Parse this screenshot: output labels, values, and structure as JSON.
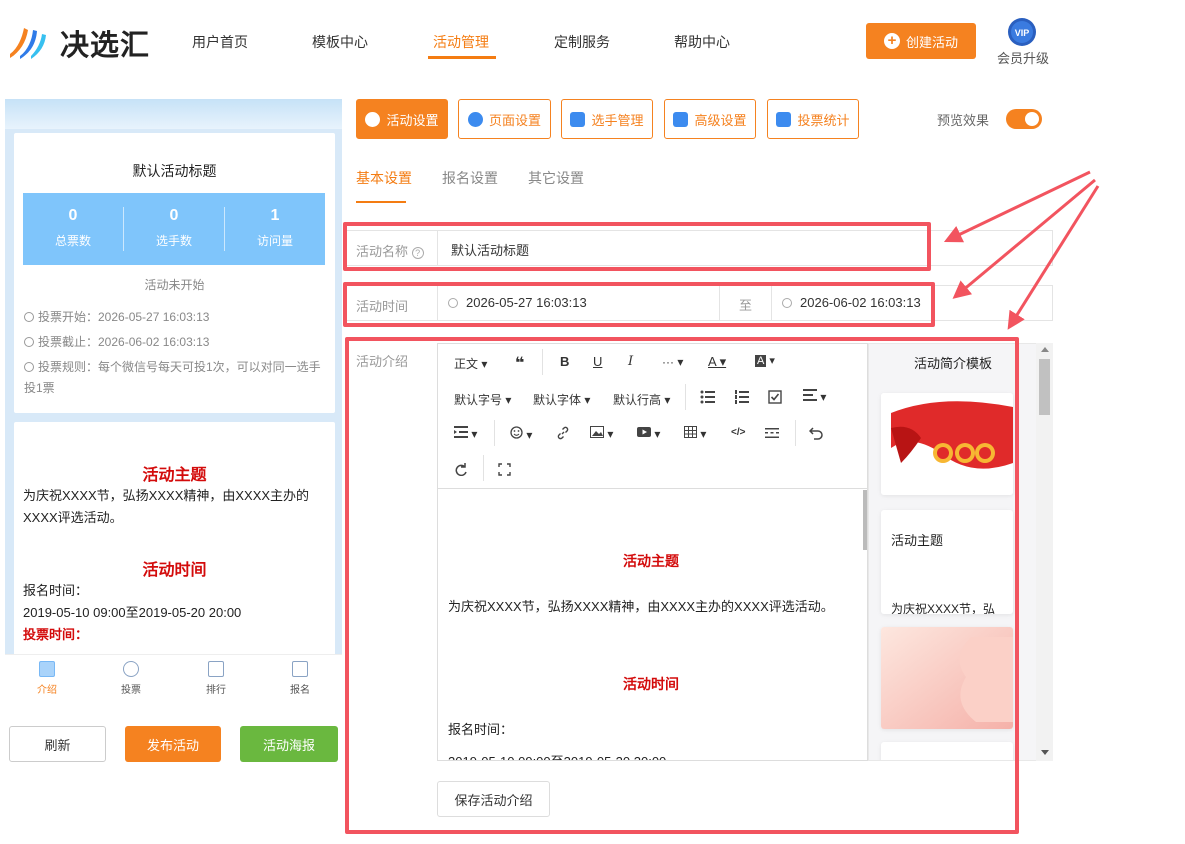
{
  "brand": {
    "name": "决选汇",
    "logo_icon": "logo-icon"
  },
  "nav": {
    "items": [
      "用户首页",
      "模板中心",
      "活动管理",
      "定制服务",
      "帮助中心"
    ],
    "active": "活动管理"
  },
  "header": {
    "create_label": "创建活动",
    "vip_badge": "VIP",
    "vip_label": "会员升级"
  },
  "preview": {
    "title": "默认活动标题",
    "stats": [
      {
        "value": "0",
        "label": "总票数"
      },
      {
        "value": "0",
        "label": "选手数"
      },
      {
        "value": "1",
        "label": "访问量"
      }
    ],
    "status": "活动未开始",
    "vote_start": "投票开始：2026-05-27 16:03:13",
    "vote_end": "投票截止：2026-06-02 16:03:13",
    "vote_rule": "投票规则：每个微信号每天可投1次，可以对同一选手投1票",
    "theme_heading": "活动主题",
    "theme_text": "为庆祝XXXX节，弘扬XXXX精神，由XXXX主办的XXXX评选活动。",
    "time_heading": "活动时间",
    "signup_label": "报名时间：",
    "signup_range": "2019-05-10 09:00至2019-05-20 20:00",
    "vote_time_label": "投票时间："
  },
  "tabbar": [
    {
      "label": "介绍",
      "icon": "intro-icon"
    },
    {
      "label": "投票",
      "icon": "vote-icon"
    },
    {
      "label": "排行",
      "icon": "ranking-icon"
    },
    {
      "label": "报名",
      "icon": "signup-icon"
    }
  ],
  "bottom_buttons": {
    "refresh": "刷新",
    "publish": "发布活动",
    "poster": "活动海报"
  },
  "toolbar_buttons": [
    {
      "label": "活动设置",
      "icon": "settings-icon"
    },
    {
      "label": "页面设置",
      "icon": "page-settings-icon"
    },
    {
      "label": "选手管理",
      "icon": "contestants-icon"
    },
    {
      "label": "高级设置",
      "icon": "advanced-settings-icon"
    },
    {
      "label": "投票统计",
      "icon": "stats-icon"
    }
  ],
  "preview_toggle": {
    "label": "预览效果",
    "on": true
  },
  "subtabs": [
    "基本设置",
    "报名设置",
    "其它设置"
  ],
  "form": {
    "name_label": "活动名称",
    "name_value": "默认活动标题",
    "time_label": "活动时间",
    "start_time": "2026-05-27 16:03:13",
    "to_label": "至",
    "end_time": "2026-06-02 16:03:13",
    "intro_label": "活动介绍"
  },
  "editor": {
    "toolbar_row1": [
      "正文",
      "❝",
      "B",
      "U",
      "I",
      "···",
      "A",
      "A"
    ],
    "toolbar_row2": [
      "默认字号",
      "默认字体",
      "默认行高"
    ],
    "body": {
      "heading1": "活动主题",
      "para1": "为庆祝XXXX节，弘扬XXXX精神，由XXXX主办的XXXX评选活动。",
      "heading2": "活动时间",
      "para2": "报名时间：",
      "para3": "2019-05-10 09:00至2019-05-20 20:00"
    },
    "save_label": "保存活动介绍"
  },
  "templates": {
    "title": "活动简介模板",
    "card2_heading": "活动主题",
    "card2_text": "为庆祝XXXX节，弘"
  },
  "colors": {
    "accent": "#f58220",
    "highlight_box": "#f2545f",
    "stats_bg": "#7fc5fb",
    "theme_red": "#d30b0b",
    "poster_green": "#6ab83f"
  }
}
